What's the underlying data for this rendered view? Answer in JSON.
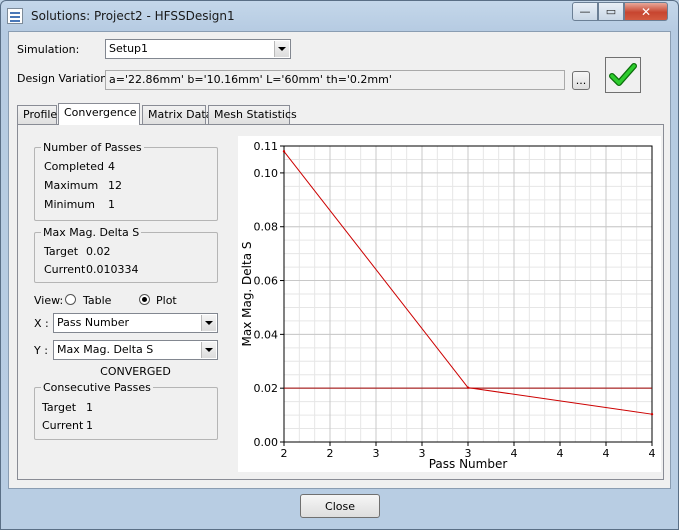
{
  "window": {
    "title": "Solutions: Project2 - HFSSDesign1",
    "min_label": "—",
    "max_label": "▭",
    "close_label": "✕"
  },
  "simulation": {
    "label": "Simulation:",
    "value": "Setup1"
  },
  "design_variation": {
    "label": "Design Variation:",
    "value": "a='22.86mm' b='10.16mm' L='60mm' th='0.2mm'",
    "browse_label": "..."
  },
  "tabs": [
    {
      "label": "Profile",
      "active": false
    },
    {
      "label": "Convergence",
      "active": true
    },
    {
      "label": "Matrix Data",
      "active": false
    },
    {
      "label": "Mesh Statistics",
      "active": false
    }
  ],
  "passes": {
    "title": "Number of Passes",
    "completed_label": "Completed",
    "completed_value": "4",
    "maximum_label": "Maximum",
    "maximum_value": "12",
    "minimum_label": "Minimum",
    "minimum_value": "1"
  },
  "delta": {
    "title": "Max Mag. Delta S",
    "target_label": "Target",
    "target_value": "0.02",
    "current_label": "Current",
    "current_value": "0.010334"
  },
  "view": {
    "label": "View:",
    "table_label": "Table",
    "plot_label": "Plot",
    "selected": "Plot"
  },
  "x_axis_select": {
    "label": "X :",
    "value": "Pass Number"
  },
  "y_axis_select": {
    "label": "Y :",
    "value": "Max Mag. Delta S"
  },
  "status_text": "CONVERGED",
  "consecutive": {
    "title": "Consecutive Passes",
    "target_label": "Target",
    "target_value": "1",
    "current_label": "Current",
    "current_value": "1"
  },
  "close_button": "Close",
  "colors": {
    "series": "#cc0000",
    "target_line": "#a00000",
    "grid_major": "#c8c8c8",
    "grid_minor": "#e6e6e6",
    "check": "#22b422"
  },
  "icons": {
    "converged": "checkmark-icon",
    "dropdown": "chevron-down-icon"
  },
  "chart_data": {
    "type": "line",
    "xlabel": "Pass Number",
    "ylabel": "Max Mag. Delta S",
    "xlim": [
      2,
      4
    ],
    "ylim": [
      0,
      0.11
    ],
    "x_tick_labels": [
      "2",
      "2",
      "3",
      "3",
      "3",
      "4",
      "4",
      "4",
      "4"
    ],
    "y_tick_labels": [
      "0.00",
      "0.02",
      "0.04",
      "0.06",
      "0.08",
      "0.10",
      "0.11"
    ],
    "y_ticks": [
      0,
      0.02,
      0.04,
      0.06,
      0.08,
      0.1,
      0.11
    ],
    "series": [
      {
        "x": [
          2,
          3,
          4
        ],
        "values": [
          0.108,
          0.0202,
          0.010334
        ]
      }
    ],
    "target_value": 0.02,
    "grid": true
  }
}
